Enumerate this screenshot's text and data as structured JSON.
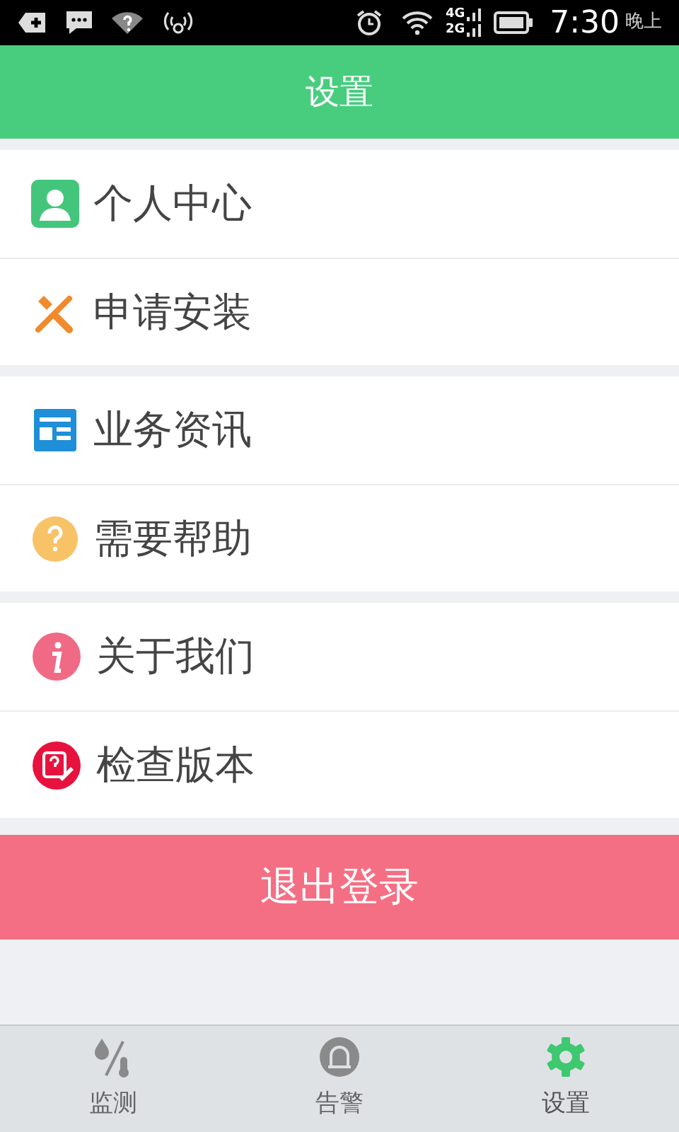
{
  "status_bar": {
    "network_top": "4G",
    "network_bottom": "2G",
    "time": "7:30",
    "period": "晚上"
  },
  "header": {
    "title": "设置"
  },
  "sections": [
    {
      "items": [
        {
          "label": "个人中心"
        },
        {
          "label": "申请安装"
        }
      ]
    },
    {
      "items": [
        {
          "label": "业务资讯"
        },
        {
          "label": "需要帮助"
        }
      ]
    },
    {
      "items": [
        {
          "label": "关于我们"
        },
        {
          "label": "检查版本"
        }
      ]
    }
  ],
  "logout_button": "退出登录",
  "bottom_nav": [
    {
      "label": "监测",
      "selected": false
    },
    {
      "label": "告警",
      "selected": false
    },
    {
      "label": "设置",
      "selected": true
    }
  ]
}
